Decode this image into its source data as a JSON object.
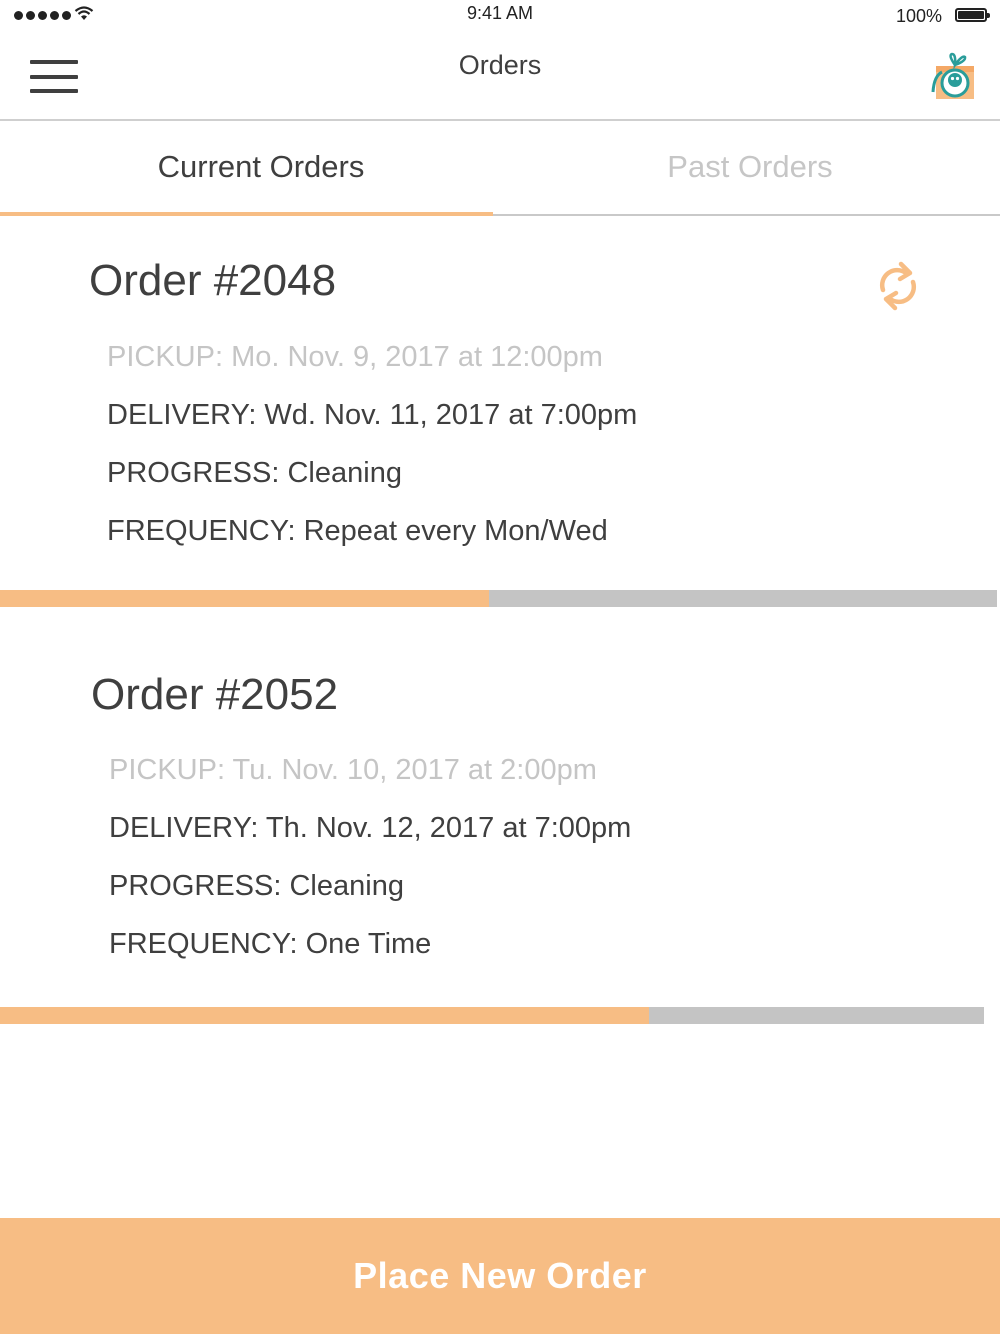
{
  "status_bar": {
    "time": "9:41 AM",
    "battery": "100%",
    "signal_icon": "signal-dots-icon",
    "wifi_icon": "wifi-icon",
    "battery_icon": "battery-icon"
  },
  "nav": {
    "title": "Orders",
    "menu_icon": "hamburger-menu-icon",
    "avatar_icon": "gift-box-profile-icon"
  },
  "tabs": [
    {
      "label": "Current Orders",
      "active": true
    },
    {
      "label": "Past Orders",
      "active": false
    }
  ],
  "orders": [
    {
      "title": "Order #2048",
      "pickup": "PICKUP: Mo. Nov. 9, 2017 at 12:00pm",
      "delivery": "DELIVERY: Wd. Nov. 11, 2017 at 7:00pm",
      "progress": "PROGRESS: Cleaning",
      "frequency": "FREQUENCY: Repeat every Mon/Wed",
      "progress_fraction": 0.49,
      "repeat_icon": "repeat-icon"
    },
    {
      "title": "Order #2052",
      "pickup": "PICKUP: Tu. Nov. 10, 2017 at 2:00pm",
      "delivery": "DELIVERY: Th. Nov. 12, 2017 at 7:00pm",
      "progress": "PROGRESS: Cleaning",
      "frequency": "FREQUENCY: One Time",
      "progress_fraction": 0.66
    }
  ],
  "cta": {
    "label": "Place New Order"
  },
  "colors": {
    "accent": "#f7bd84",
    "track": "#c4c4c4",
    "text": "#3f3f3f",
    "muted": "#c5c5c5",
    "teal": "#2a9d9a"
  }
}
